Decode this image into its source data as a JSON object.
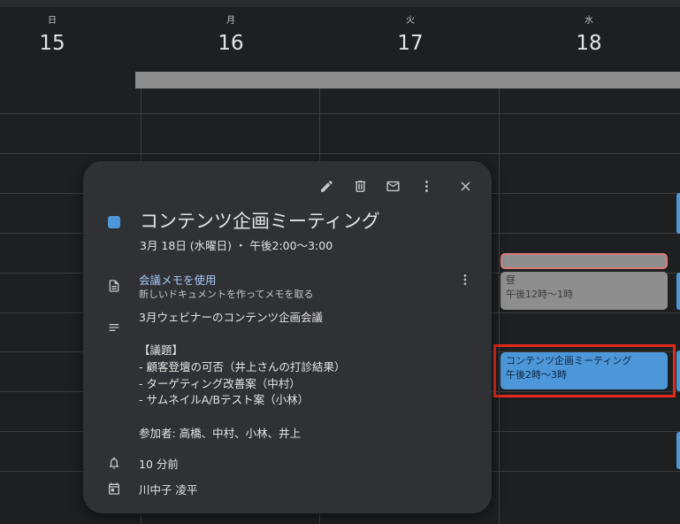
{
  "calendar": {
    "days": [
      {
        "dow": "日",
        "num": "15"
      },
      {
        "dow": "月",
        "num": "16"
      },
      {
        "dow": "火",
        "num": "17"
      },
      {
        "dow": "水",
        "num": "18"
      }
    ],
    "events": {
      "lunch": {
        "title": "昼",
        "time": "午後12時～1時"
      },
      "meeting": {
        "title": "コンテンツ企画ミーティング",
        "time": "午後2時～3時"
      }
    },
    "colors": {
      "event_blue": "#4d97d8",
      "event_gray": "#8e8e8e",
      "highlight": "#e3291c"
    }
  },
  "popup": {
    "toolbar": {
      "edit_icon": "pencil-icon",
      "delete_icon": "trash-icon",
      "email_icon": "mail-icon",
      "more_icon": "more-vert-icon",
      "close_icon": "close-icon"
    },
    "title": "コンテンツ企画ミーティング",
    "datetime": "3月 18日 (水曜日) ・ 午後2:00～3:00",
    "notes": {
      "link": "会議メモを使用",
      "subtitle": "新しいドキュメントを作ってメモを取る"
    },
    "description": [
      "3月ウェビナーのコンテンツ企画会議",
      "",
      "【議題】",
      "- 顧客登壇の可否（井上さんの打診結果）",
      "- ターゲティング改善案（中村）",
      "- サムネイルA/Bテスト案（小林）",
      "",
      "参加者: 高橋、中村、小林、井上"
    ],
    "reminder": "10 分前",
    "owner": "川中子 凌平"
  }
}
